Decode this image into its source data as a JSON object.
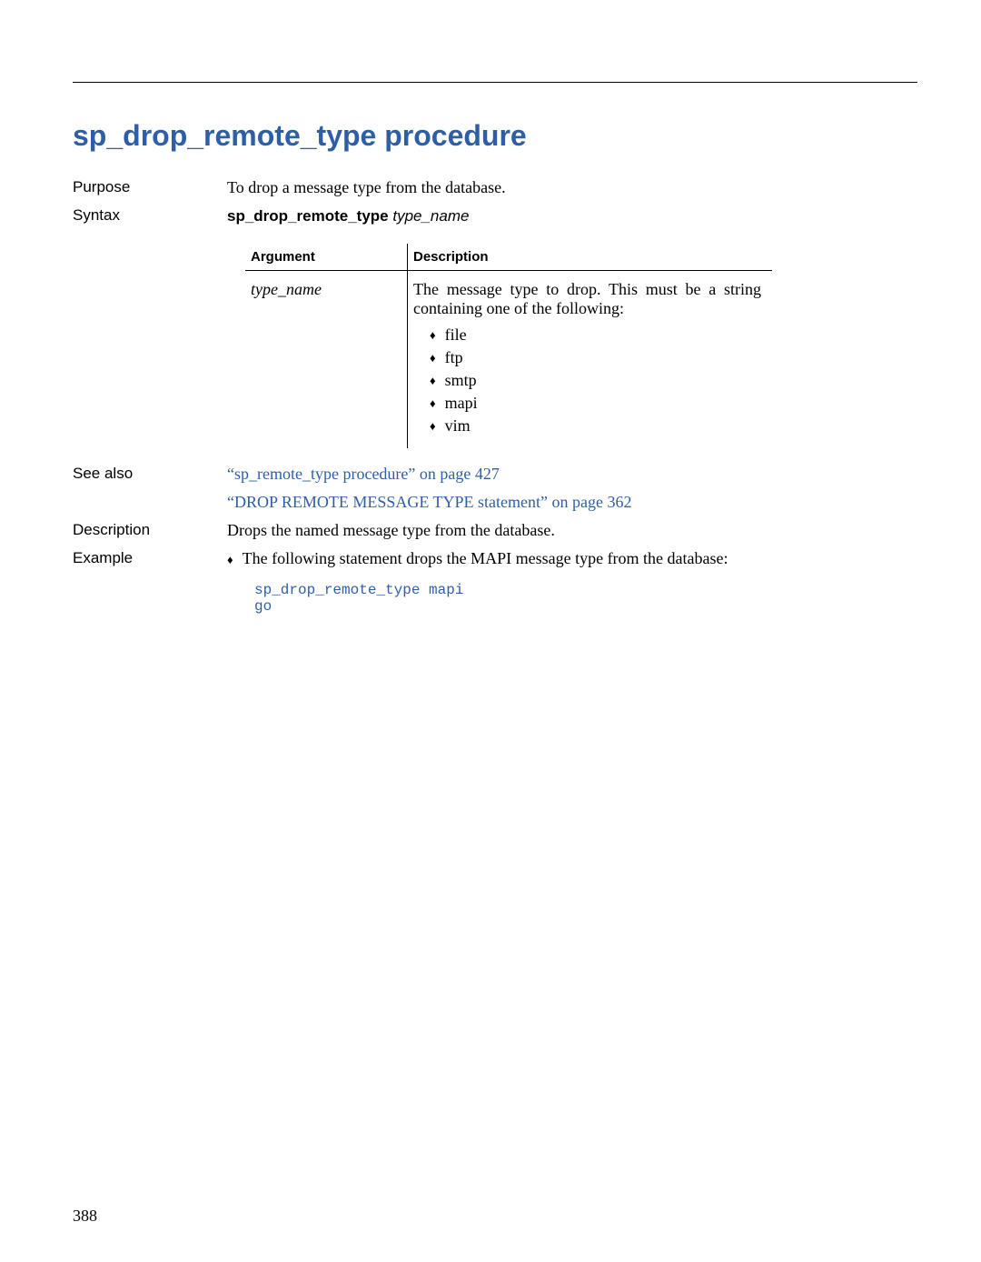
{
  "title": "sp_drop_remote_type procedure",
  "labels": {
    "purpose": "Purpose",
    "syntax": "Syntax",
    "seealso": "See also",
    "description": "Description",
    "example": "Example"
  },
  "purpose_text": "To drop a message type from the database.",
  "syntax": {
    "cmd": "sp_drop_remote_type ",
    "arg": "type_name"
  },
  "table": {
    "head_arg": "Argument",
    "head_desc": "Description",
    "arg_name": "type_name",
    "desc_intro": "The message type to drop.  This must be a string containing one of the following:",
    "types": [
      "file",
      "ftp",
      "smtp",
      "mapi",
      "vim"
    ]
  },
  "seealso": {
    "link1": "“sp_remote_type procedure” on page 427",
    "link2": "“DROP REMOTE MESSAGE TYPE statement” on page 362"
  },
  "description_text": "Drops the named message type from the database.",
  "example": {
    "intro": "The following statement drops the MAPI message type from the database:",
    "code": "sp_drop_remote_type mapi\ngo"
  },
  "page_number": "388"
}
